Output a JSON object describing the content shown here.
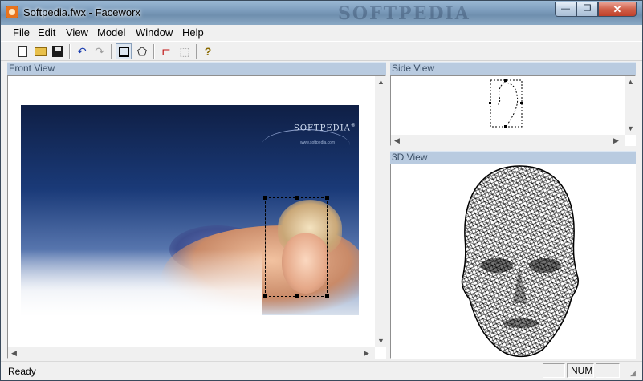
{
  "window": {
    "title": "Softpedia.fwx - Faceworx",
    "watermark": "SOFTPEDIA"
  },
  "titlebar_buttons": {
    "minimize": "—",
    "maximize": "❐",
    "close": "✕"
  },
  "menu": [
    "File",
    "Edit",
    "View",
    "Model",
    "Window",
    "Help"
  ],
  "toolbar": {
    "new": "new-file-icon",
    "open": "open-folder-icon",
    "save": "save-icon",
    "undo": "↶",
    "redo": "↷",
    "select": "select-rect-icon",
    "polygon": "⬠",
    "point_add": "⊏",
    "point_mode": "⬚",
    "help": "?"
  },
  "panels": {
    "front": "Front View",
    "side": "Side View",
    "view3d": "3D View"
  },
  "photo": {
    "logo": "SOFTPEDIA",
    "logo_mark": "®",
    "site": "www.softpedia.com"
  },
  "status": {
    "text": "Ready",
    "num": "NUM"
  }
}
